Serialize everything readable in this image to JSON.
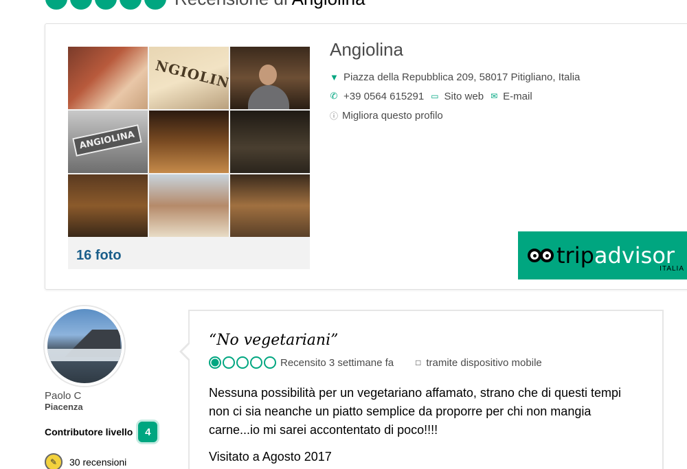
{
  "header": {
    "prefix": "Recensione di ",
    "restaurant": "Angiolina"
  },
  "restaurant": {
    "name": "Angiolina",
    "address": "Piazza della Repubblica 209, 58017 Pitigliano, Italia",
    "phone": "+39 0564 615291",
    "website_label": "Sito web",
    "email_label": "E-mail",
    "improve_label": "Migliora questo profilo",
    "photo_count": "16 foto",
    "photo_signs": {
      "wood_sign": "ANGIOLINA",
      "table_print": "NGIOLIN"
    }
  },
  "logo": {
    "trip": "trip",
    "advisor": "advisor",
    "country": "ITALIA"
  },
  "reviewer": {
    "name": "Paolo C",
    "city": "Piacenza",
    "level_label": "Contributore livello",
    "level": "4",
    "reviews_count": "30 recensioni"
  },
  "review": {
    "title": "“No vegetariani”",
    "rating": 1,
    "rating_max": 5,
    "reviewed_when": "Recensito 3 settimane fa",
    "device": "tramite dispositivo mobile",
    "text": "Nessuna possibilità per un vegetariano affamato, strano che di questi tempi non ci sia neanche un piatto semplice da proporre per chi non mangia carne...io mi sarei accontentato di poco!!!!",
    "visited": "Visitato a Agosto 2017"
  },
  "colors": {
    "accent": "#00a680",
    "link": "#1a5e8a"
  }
}
